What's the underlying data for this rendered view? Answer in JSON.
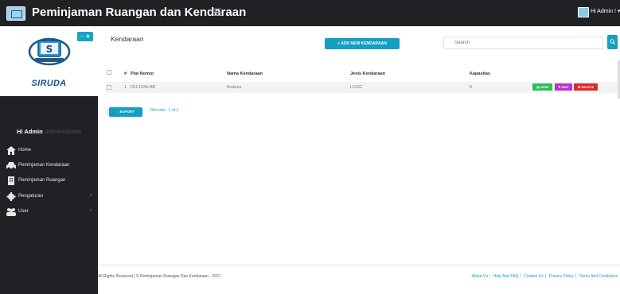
{
  "header": {
    "title": "Peminjaman Ruangan dan Kendaraan",
    "menu_icon": "hamburger-icon",
    "user_label": "Hi Admin !"
  },
  "sidebar": {
    "brand_name": "SIRUDA",
    "greeting": "Hi Admin",
    "role": "Administrator",
    "items": [
      {
        "label": "Home",
        "icon": "home-icon"
      },
      {
        "label": "Peminjaman Kendaraan",
        "icon": "car-icon"
      },
      {
        "label": "Peminjaman Ruangan",
        "icon": "building-icon"
      },
      {
        "label": "Pengaturan",
        "icon": "gear-icon"
      },
      {
        "label": "User",
        "icon": "users-icon"
      }
    ]
  },
  "main": {
    "heading": "Kendaraan",
    "add_button": "+ ADD NEW KENDARAAN",
    "search_placeholder": "Search",
    "table": {
      "headers": [
        "#",
        "Plat Nomor",
        "Nama Kendaraan",
        "Jenis Kendaraan",
        "Kapasitas"
      ],
      "rows": [
        {
          "no": "1",
          "plat": "DH-1234-AB",
          "nama": "Avanza",
          "jenis": "LCGC",
          "kapasitas": "5"
        }
      ],
      "actions": {
        "view": "◉ VIEW",
        "edit": "✎ EDIT",
        "delete": "✖ DELETE"
      }
    },
    "export_button": "↓ EXPORT",
    "records_text": "Records : 1 of 1"
  },
  "footer": {
    "copyright": "All Rights Reserved | © Peminjaman Ruangan Dan Kendaraan - 2021",
    "links": [
      "About Us",
      "Help And FAQ",
      "Contact Us",
      "Privacy Policy",
      "Terms And Conditions"
    ]
  },
  "colors": {
    "accent": "#149ec0",
    "dark": "#1f2124",
    "view": "#2fbf5e",
    "edit": "#b636c9",
    "delete": "#e0282f"
  }
}
